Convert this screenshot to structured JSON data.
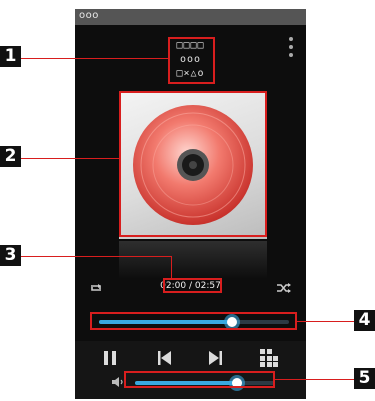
{
  "status_bar": {
    "text": "ooo"
  },
  "track": {
    "line1": "□□□□",
    "line2": "ooo",
    "line3": "□×△o"
  },
  "playback": {
    "current_time": "02:00",
    "separator": " / ",
    "total_time": "02:57",
    "progress_fraction": 0.7
  },
  "volume": {
    "level_fraction": 0.73
  },
  "icons": {
    "overflow": "overflow-menu-icon",
    "repeat": "repeat-icon",
    "shuffle": "shuffle-icon",
    "pause": "pause-icon",
    "previous": "previous-track-icon",
    "next": "next-track-icon",
    "playlist": "playlist-icon",
    "volume": "volume-icon",
    "album_art": "cd-disc-icon"
  },
  "callouts": [
    "1",
    "2",
    "3",
    "4",
    "5"
  ],
  "colors": {
    "accent": "#38a8e0",
    "callout_border": "#d81e1e",
    "disc": "#e8695f"
  }
}
